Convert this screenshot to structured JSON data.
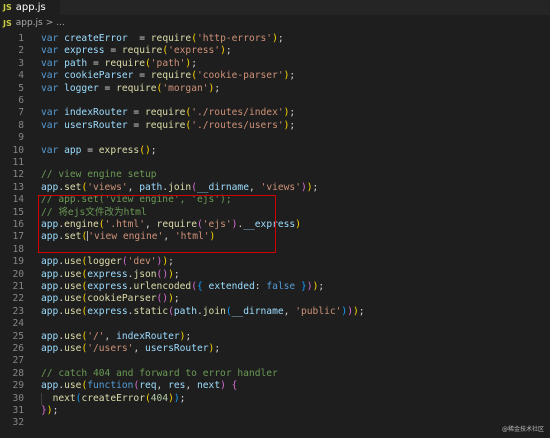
{
  "tab": {
    "icon": "JS",
    "title": "app.js"
  },
  "breadcrumb": {
    "icon": "JS",
    "file": "app.js",
    "separator": ">",
    "more": "..."
  },
  "lines": [
    {
      "n": "1",
      "segs": [
        [
          "kw",
          "var "
        ],
        [
          "var",
          "createError"
        ],
        [
          "",
          "  = "
        ],
        [
          "fn",
          "require"
        ],
        [
          "br",
          "("
        ],
        [
          "str",
          "'http-errors'"
        ],
        [
          "br",
          ")"
        ],
        [
          "",
          ";"
        ]
      ]
    },
    {
      "n": "2",
      "segs": [
        [
          "kw",
          "var "
        ],
        [
          "var",
          "express"
        ],
        [
          "",
          " = "
        ],
        [
          "fn",
          "require"
        ],
        [
          "br",
          "("
        ],
        [
          "str",
          "'express'"
        ],
        [
          "br",
          ")"
        ],
        [
          "",
          ";"
        ]
      ]
    },
    {
      "n": "3",
      "segs": [
        [
          "kw",
          "var "
        ],
        [
          "var",
          "path"
        ],
        [
          "",
          " = "
        ],
        [
          "fn",
          "require"
        ],
        [
          "br",
          "("
        ],
        [
          "str",
          "'path'"
        ],
        [
          "br",
          ")"
        ],
        [
          "",
          ";"
        ]
      ]
    },
    {
      "n": "4",
      "segs": [
        [
          "kw",
          "var "
        ],
        [
          "var",
          "cookieParser"
        ],
        [
          "",
          " = "
        ],
        [
          "fn",
          "require"
        ],
        [
          "br",
          "("
        ],
        [
          "str",
          "'cookie-parser'"
        ],
        [
          "br",
          ")"
        ],
        [
          "",
          ";"
        ]
      ]
    },
    {
      "n": "5",
      "segs": [
        [
          "kw",
          "var "
        ],
        [
          "var",
          "logger"
        ],
        [
          "",
          " = "
        ],
        [
          "fn",
          "require"
        ],
        [
          "br",
          "("
        ],
        [
          "str",
          "'morgan'"
        ],
        [
          "br",
          ")"
        ],
        [
          "",
          ";"
        ]
      ]
    },
    {
      "n": "6",
      "segs": []
    },
    {
      "n": "7",
      "segs": [
        [
          "kw",
          "var "
        ],
        [
          "var",
          "indexRouter"
        ],
        [
          "",
          " = "
        ],
        [
          "fn",
          "require"
        ],
        [
          "br",
          "("
        ],
        [
          "str",
          "'./routes/index'"
        ],
        [
          "br",
          ")"
        ],
        [
          "",
          ";"
        ]
      ]
    },
    {
      "n": "8",
      "segs": [
        [
          "kw",
          "var "
        ],
        [
          "var",
          "usersRouter"
        ],
        [
          "",
          " = "
        ],
        [
          "fn",
          "require"
        ],
        [
          "br",
          "("
        ],
        [
          "str",
          "'./routes/users'"
        ],
        [
          "br",
          ")"
        ],
        [
          "",
          ";"
        ]
      ]
    },
    {
      "n": "9",
      "segs": []
    },
    {
      "n": "10",
      "segs": [
        [
          "kw",
          "var "
        ],
        [
          "var",
          "app"
        ],
        [
          "",
          " = "
        ],
        [
          "fn",
          "express"
        ],
        [
          "br",
          "()"
        ],
        [
          "",
          ";"
        ]
      ]
    },
    {
      "n": "11",
      "segs": []
    },
    {
      "n": "12",
      "segs": [
        [
          "cm",
          "// view engine setup"
        ]
      ]
    },
    {
      "n": "13",
      "segs": [
        [
          "var",
          "app"
        ],
        [
          "",
          "."
        ],
        [
          "fn",
          "set"
        ],
        [
          "br",
          "("
        ],
        [
          "str",
          "'views'"
        ],
        [
          "",
          ", "
        ],
        [
          "var",
          "path"
        ],
        [
          "",
          "."
        ],
        [
          "fn",
          "join"
        ],
        [
          "br2",
          "("
        ],
        [
          "var",
          "__dirname"
        ],
        [
          "",
          ", "
        ],
        [
          "str",
          "'views'"
        ],
        [
          "br2",
          ")"
        ],
        [
          "br",
          ")"
        ],
        [
          "",
          ";"
        ]
      ]
    },
    {
      "n": "14",
      "segs": [
        [
          "cm",
          "// app.set('view engine', 'ejs');"
        ]
      ]
    },
    {
      "n": "15",
      "segs": [
        [
          "cm",
          "// 将ejs文件改为html"
        ]
      ]
    },
    {
      "n": "16",
      "segs": [
        [
          "var",
          "app"
        ],
        [
          "",
          "."
        ],
        [
          "fn",
          "engine"
        ],
        [
          "br",
          "("
        ],
        [
          "str",
          "'.html'"
        ],
        [
          "",
          ", "
        ],
        [
          "fn",
          "require"
        ],
        [
          "br2",
          "("
        ],
        [
          "str",
          "'ejs'"
        ],
        [
          "br2",
          ")"
        ],
        [
          "",
          "."
        ],
        [
          "var",
          "__express"
        ],
        [
          "br",
          ")"
        ]
      ]
    },
    {
      "n": "17",
      "segs": [
        [
          "var",
          "app"
        ],
        [
          "",
          "."
        ],
        [
          "fn",
          "set"
        ],
        [
          "br",
          "("
        ],
        [
          "str",
          "'view engine'"
        ],
        [
          "",
          ", "
        ],
        [
          "str",
          "'html'"
        ],
        [
          "br",
          ")"
        ]
      ],
      "cursor": true
    },
    {
      "n": "18",
      "segs": []
    },
    {
      "n": "19",
      "segs": [
        [
          "var",
          "app"
        ],
        [
          "",
          "."
        ],
        [
          "fn",
          "use"
        ],
        [
          "br",
          "("
        ],
        [
          "fn",
          "logger"
        ],
        [
          "br2",
          "("
        ],
        [
          "str",
          "'dev'"
        ],
        [
          "br2",
          ")"
        ],
        [
          "br",
          ")"
        ],
        [
          "",
          ";"
        ]
      ]
    },
    {
      "n": "20",
      "segs": [
        [
          "var",
          "app"
        ],
        [
          "",
          "."
        ],
        [
          "fn",
          "use"
        ],
        [
          "br",
          "("
        ],
        [
          "var",
          "express"
        ],
        [
          "",
          "."
        ],
        [
          "fn",
          "json"
        ],
        [
          "br2",
          "()"
        ],
        [
          "br",
          ")"
        ],
        [
          "",
          ";"
        ]
      ]
    },
    {
      "n": "21",
      "segs": [
        [
          "var",
          "app"
        ],
        [
          "",
          "."
        ],
        [
          "fn",
          "use"
        ],
        [
          "br",
          "("
        ],
        [
          "var",
          "express"
        ],
        [
          "",
          "."
        ],
        [
          "fn",
          "urlencoded"
        ],
        [
          "br2",
          "("
        ],
        [
          "br3",
          "{ "
        ],
        [
          "var",
          "extended"
        ],
        [
          "",
          ": "
        ],
        [
          "kw",
          "false"
        ],
        [
          "br3",
          " }"
        ],
        [
          "br2",
          ")"
        ],
        [
          "br",
          ")"
        ],
        [
          "",
          ";"
        ]
      ]
    },
    {
      "n": "22",
      "segs": [
        [
          "var",
          "app"
        ],
        [
          "",
          "."
        ],
        [
          "fn",
          "use"
        ],
        [
          "br",
          "("
        ],
        [
          "fn",
          "cookieParser"
        ],
        [
          "br2",
          "()"
        ],
        [
          "br",
          ")"
        ],
        [
          "",
          ";"
        ]
      ]
    },
    {
      "n": "23",
      "segs": [
        [
          "var",
          "app"
        ],
        [
          "",
          "."
        ],
        [
          "fn",
          "use"
        ],
        [
          "br",
          "("
        ],
        [
          "var",
          "express"
        ],
        [
          "",
          "."
        ],
        [
          "fn",
          "static"
        ],
        [
          "br2",
          "("
        ],
        [
          "var",
          "path"
        ],
        [
          "",
          "."
        ],
        [
          "fn",
          "join"
        ],
        [
          "br3",
          "("
        ],
        [
          "var",
          "__dirname"
        ],
        [
          "",
          ", "
        ],
        [
          "str",
          "'public'"
        ],
        [
          "br3",
          ")"
        ],
        [
          "br2",
          ")"
        ],
        [
          "br",
          ")"
        ],
        [
          "",
          ";"
        ]
      ]
    },
    {
      "n": "24",
      "segs": []
    },
    {
      "n": "25",
      "segs": [
        [
          "var",
          "app"
        ],
        [
          "",
          "."
        ],
        [
          "fn",
          "use"
        ],
        [
          "br",
          "("
        ],
        [
          "str",
          "'/'"
        ],
        [
          "",
          ", "
        ],
        [
          "var",
          "indexRouter"
        ],
        [
          "br",
          ")"
        ],
        [
          "",
          ";"
        ]
      ]
    },
    {
      "n": "26",
      "segs": [
        [
          "var",
          "app"
        ],
        [
          "",
          "."
        ],
        [
          "fn",
          "use"
        ],
        [
          "br",
          "("
        ],
        [
          "str",
          "'/users'"
        ],
        [
          "",
          ", "
        ],
        [
          "var",
          "usersRouter"
        ],
        [
          "br",
          ")"
        ],
        [
          "",
          ";"
        ]
      ]
    },
    {
      "n": "27",
      "segs": []
    },
    {
      "n": "28",
      "segs": [
        [
          "cm",
          "// catch 404 and forward to error handler"
        ]
      ]
    },
    {
      "n": "29",
      "segs": [
        [
          "var",
          "app"
        ],
        [
          "",
          "."
        ],
        [
          "fn",
          "use"
        ],
        [
          "br",
          "("
        ],
        [
          "kw",
          "function"
        ],
        [
          "br2",
          "("
        ],
        [
          "var",
          "req"
        ],
        [
          "",
          ", "
        ],
        [
          "var",
          "res"
        ],
        [
          "",
          ", "
        ],
        [
          "var",
          "next"
        ],
        [
          "br2",
          ")"
        ],
        [
          "",
          " "
        ],
        [
          "br2",
          "{"
        ]
      ]
    },
    {
      "n": "30",
      "segs": [
        [
          "",
          "  "
        ],
        [
          "fn",
          "next"
        ],
        [
          "br3",
          "("
        ],
        [
          "fn",
          "createError"
        ],
        [
          "br",
          "("
        ],
        [
          "num",
          "404"
        ],
        [
          "br",
          ")"
        ],
        [
          "br3",
          ")"
        ],
        [
          "",
          ";"
        ]
      ],
      "guide": true
    },
    {
      "n": "31",
      "segs": [
        [
          "br2",
          "}"
        ],
        [
          "br",
          ")"
        ],
        [
          "",
          ";"
        ]
      ]
    },
    {
      "n": "32",
      "segs": []
    }
  ],
  "watermark": "@稀金技术社区"
}
